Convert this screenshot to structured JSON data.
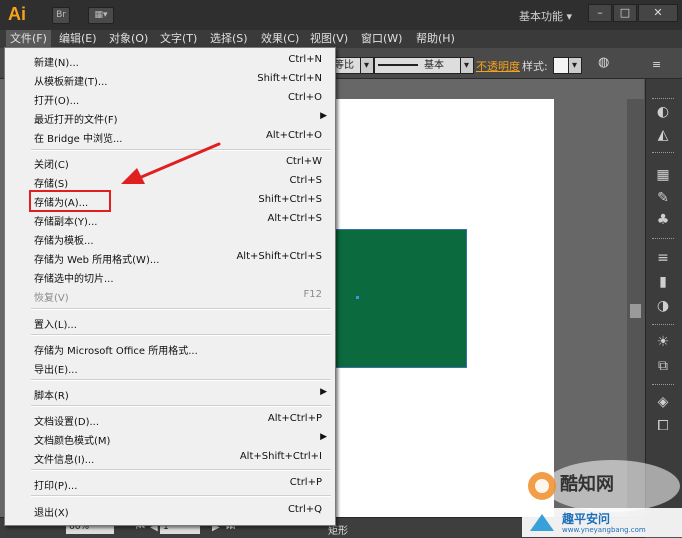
{
  "app": {
    "logo_text": "Ai",
    "br_label": "Br",
    "workspace_label": "基本功能",
    "workspace_caret": "▾"
  },
  "window_controls": {
    "minimize": "–",
    "maximize": "□",
    "close": "✕"
  },
  "menubar": {
    "items": [
      {
        "label": "文件(F)"
      },
      {
        "label": "编辑(E)"
      },
      {
        "label": "对象(O)"
      },
      {
        "label": "文字(T)"
      },
      {
        "label": "选择(S)"
      },
      {
        "label": "效果(C)"
      },
      {
        "label": "视图(V)"
      },
      {
        "label": "窗口(W)"
      },
      {
        "label": "帮助(H)"
      }
    ]
  },
  "controlbar": {
    "variable_width": "等比",
    "stroke_style": "基本",
    "opacity_link": "不透明度",
    "style_label": "样式:"
  },
  "file_menu": {
    "items": [
      {
        "label": "新建(N)...",
        "shortcut": "Ctrl+N"
      },
      {
        "label": "从模板新建(T)...",
        "shortcut": "Shift+Ctrl+N"
      },
      {
        "label": "打开(O)...",
        "shortcut": "Ctrl+O"
      },
      {
        "label": "最近打开的文件(F)",
        "shortcut": "",
        "submenu": "▶"
      },
      {
        "label": "在 Bridge 中浏览...",
        "shortcut": "Alt+Ctrl+O"
      },
      {
        "label": "关闭(C)",
        "shortcut": "Ctrl+W"
      },
      {
        "label": "存储(S)",
        "shortcut": "Ctrl+S"
      },
      {
        "label": "存储为(A)...",
        "shortcut": "Shift+Ctrl+S"
      },
      {
        "label": "存储副本(Y)...",
        "shortcut": "Alt+Ctrl+S"
      },
      {
        "label": "存储为模板...",
        "shortcut": ""
      },
      {
        "label": "存储为 Web 所用格式(W)...",
        "shortcut": "Alt+Shift+Ctrl+S"
      },
      {
        "label": "存储选中的切片...",
        "shortcut": ""
      },
      {
        "label": "恢复(V)",
        "shortcut": "F12",
        "disabled": true
      },
      {
        "label": "置入(L)...",
        "shortcut": ""
      },
      {
        "label": "存储为 Microsoft Office 所用格式...",
        "shortcut": ""
      },
      {
        "label": "导出(E)...",
        "shortcut": ""
      },
      {
        "label": "脚本(R)",
        "shortcut": "",
        "submenu": "▶"
      },
      {
        "label": "文档设置(D)...",
        "shortcut": "Alt+Ctrl+P"
      },
      {
        "label": "文档颜色模式(M)",
        "shortcut": "",
        "submenu": "▶"
      },
      {
        "label": "文件信息(I)...",
        "shortcut": "Alt+Shift+Ctrl+I"
      },
      {
        "label": "打印(P)...",
        "shortcut": "Ctrl+P"
      },
      {
        "label": "退出(X)",
        "shortcut": "Ctrl+Q"
      }
    ]
  },
  "statusbar": {
    "zoom": "66%",
    "page": "1",
    "tool": "矩形"
  },
  "watermark": {
    "brand": "酷知网",
    "site_name": "趣平安问",
    "site_url": "www.yneyangbang.com"
  },
  "colors": {
    "accent_orange": "#f7a21b",
    "shape_green": "#0b6a3e",
    "highlight_red": "#e02020"
  }
}
